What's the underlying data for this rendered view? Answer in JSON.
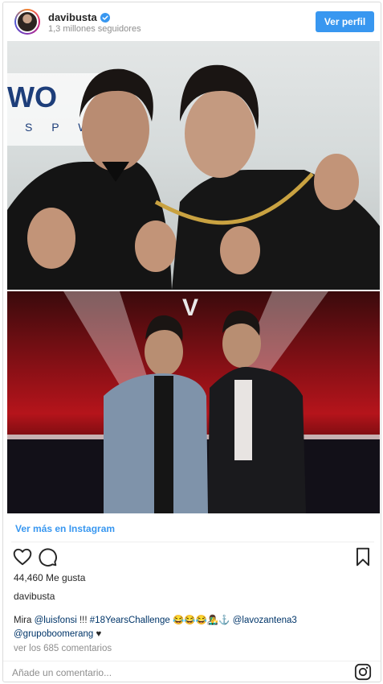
{
  "header": {
    "username": "davibusta",
    "followers": "1,3 millones seguidores",
    "follow_label": "Ver perfil"
  },
  "photo": {
    "top_sign_text": "WO",
    "top_sign_sub": "S P   W E",
    "bottom_logo": "V"
  },
  "footer": {
    "more_link": "Ver más en Instagram",
    "likes": "44,460 Me gusta",
    "owner": "davibusta",
    "caption": {
      "prefix": "Mira ",
      "mention1": "@luisfonsi",
      "text1": " !!! ",
      "hashtag": "#18YearsChallenge",
      "emojis": " 😂😂😂👨‍🎤⚓ ",
      "mention2": "@lavozantena3",
      "mention3": "@grupoboomerang",
      "heart": " ♥"
    },
    "comments_link": "ver los 685 comentarios",
    "comment_placeholder": "Añade un comentario..."
  },
  "icons": {
    "verified": "verified-badge-icon",
    "like": "heart-icon",
    "comment": "comment-icon",
    "save": "bookmark-icon",
    "brand": "instagram-icon"
  },
  "colors": {
    "accent": "#3897f0",
    "link": "#003569",
    "muted": "#8e8e8e"
  }
}
